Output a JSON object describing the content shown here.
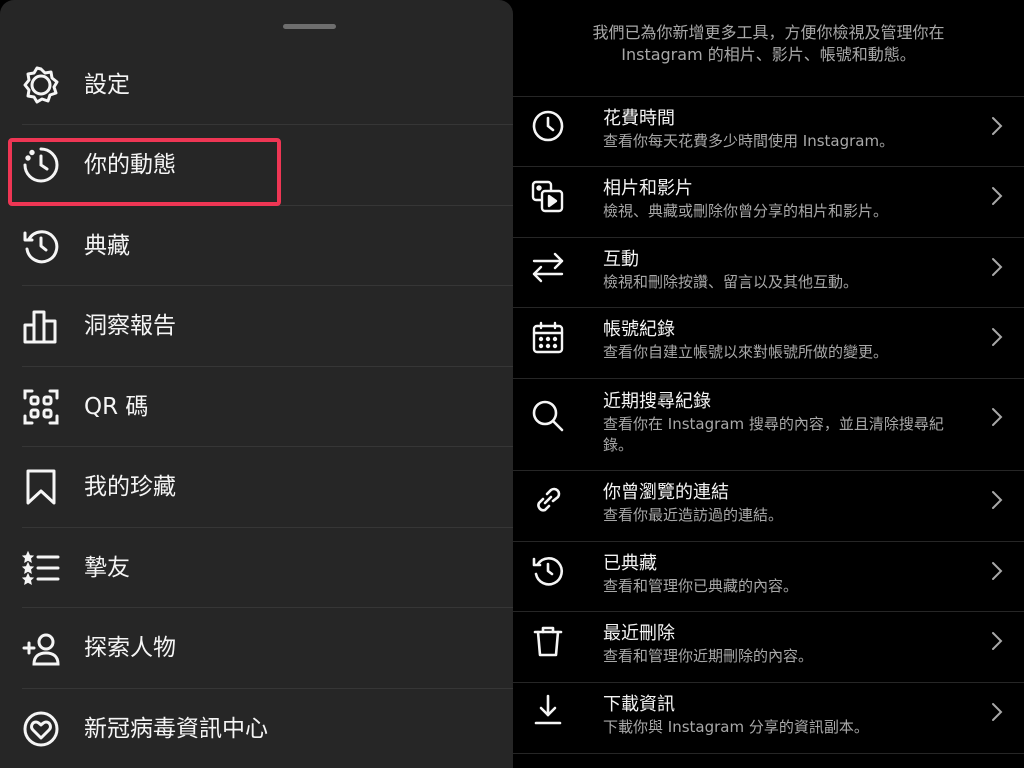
{
  "menu": {
    "items": [
      {
        "label": "設定",
        "icon": "gear-icon"
      },
      {
        "label": "你的動態",
        "icon": "activity-icon"
      },
      {
        "label": "典藏",
        "icon": "archive-icon"
      },
      {
        "label": "洞察報告",
        "icon": "insights-icon"
      },
      {
        "label": "QR 碼",
        "icon": "qr-code-icon"
      },
      {
        "label": "我的珍藏",
        "icon": "bookmark-icon"
      },
      {
        "label": "摯友",
        "icon": "close-friends-icon"
      },
      {
        "label": "探索人物",
        "icon": "add-person-icon"
      },
      {
        "label": "新冠病毒資訊中心",
        "icon": "covid-info-icon"
      }
    ],
    "highlight_color": "#ee3654"
  },
  "activity": {
    "intro_line1": "我們已為你新增更多工具，方便你檢視及管理你在",
    "intro_line2": "Instagram 的相片、影片、帳號和動態。",
    "rows": [
      {
        "title": "花費時間",
        "desc": "查看你每天花費多少時間使用 Instagram。",
        "icon": "clock-icon"
      },
      {
        "title": "相片和影片",
        "desc": "檢視、典藏或刪除你曾分享的相片和影片。",
        "icon": "photos-videos-icon"
      },
      {
        "title": "互動",
        "desc": "檢視和刪除按讚、留言以及其他互動。",
        "icon": "interactions-icon"
      },
      {
        "title": "帳號紀錄",
        "desc": "查看你自建立帳號以來對帳號所做的變更。",
        "icon": "calendar-icon"
      },
      {
        "title": "近期搜尋紀錄",
        "desc": "查看你在 Instagram 搜尋的內容，並且清除搜尋紀錄。",
        "icon": "search-icon"
      },
      {
        "title": "你曾瀏覽的連結",
        "desc": "查看你最近造訪過的連結。",
        "icon": "link-icon"
      },
      {
        "title": "已典藏",
        "desc": "查看和管理你已典藏的內容。",
        "icon": "archive-icon"
      },
      {
        "title": "最近刪除",
        "desc": "查看和管理你近期刪除的內容。",
        "icon": "trash-icon"
      },
      {
        "title": "下載資訊",
        "desc": "下載你與 Instagram 分享的資訊副本。",
        "icon": "download-icon"
      }
    ]
  }
}
